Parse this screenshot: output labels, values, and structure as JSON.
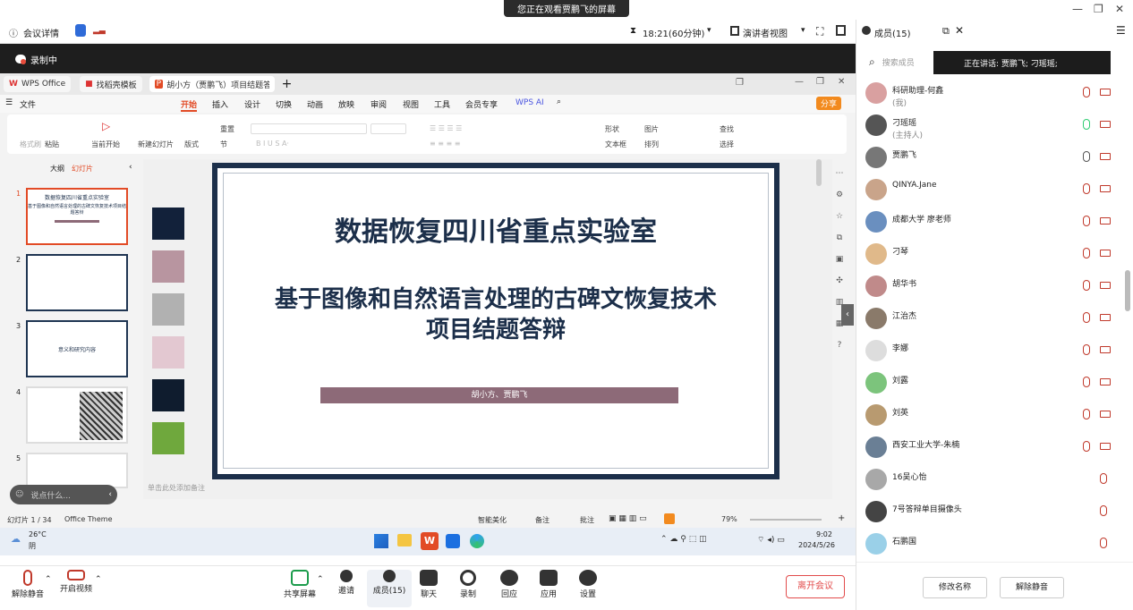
{
  "window": {
    "share_banner": "您正在观看贾鹏飞的屏幕"
  },
  "meeting_bar": {
    "details": "会议详情",
    "time": "18:21(60分钟)",
    "view": "演讲者视图",
    "members_title": "成员(15)"
  },
  "recording": {
    "label": "录制中"
  },
  "wps": {
    "tabs": [
      {
        "label": "WPS Office"
      },
      {
        "label": "找稻壳模板"
      },
      {
        "label": "胡小方（贾鹏飞）项目结题答..."
      }
    ],
    "menus": [
      "文件",
      "开始",
      "插入",
      "设计",
      "切换",
      "动画",
      "放映",
      "审阅",
      "视图",
      "工具",
      "会员专享"
    ],
    "wps_ai": "WPS AI",
    "share": "分享",
    "ribbon": {
      "format_brush": "格式刷",
      "paste": "粘贴",
      "play_from_current": "当前开始",
      "new_slide": "新建幻灯片",
      "layout": "版式",
      "section": "节",
      "reset": "重置",
      "shape": "形状",
      "picture": "图片",
      "textbox": "文本框",
      "arrange": "排列",
      "find": "查找",
      "replace": "替换",
      "select": "选择"
    },
    "panel_tabs": [
      "大纲",
      "幻灯片"
    ],
    "slide_numbers": [
      "1",
      "2",
      "3",
      "4",
      "5"
    ],
    "thumb1": {
      "title": "数据恢复四川省重点实验室",
      "sub": "基于图像和自然语言处理的古碑文恢复技术项目结题答辩"
    },
    "thumb3": {
      "title": "意义和研究内容"
    },
    "comment_placeholder": "说点什么...",
    "notes_hint": "单击此处添加备注",
    "status": {
      "slide_count": "幻灯片 1 / 34",
      "theme": "Office Theme",
      "beautify": "智能美化",
      "notes": "备注",
      "comments": "批注",
      "zoom": "79%"
    }
  },
  "slide": {
    "title": "数据恢复四川省重点实验室",
    "subtitle_line1": "基于图像和自然语言处理的古碑文恢复技术",
    "subtitle_line2": "项目结题答辩",
    "authors": "胡小方、贾鹏飞"
  },
  "swatches": [
    "#12213a",
    "#b895a0",
    "#b1b1b1",
    "#e3c8d1",
    "#0f1c2e",
    "#6fa83d"
  ],
  "taskbar": {
    "temp": "26°C",
    "weather": "阴",
    "time": "9:02",
    "date": "2024/5/26"
  },
  "bottom_bar": {
    "unmute": "解除静音",
    "start_video": "开启视频",
    "share_screen": "共享屏幕",
    "invite": "邀请",
    "members": "成员(15)",
    "chat": "聊天",
    "record": "录制",
    "replay": "回应",
    "apps": "应用",
    "settings": "设置",
    "leave": "离开会议"
  },
  "sidebar": {
    "search_placeholder": "搜索成员",
    "speaking": "正在讲话:  贾鹏飞; 刁瑶瑶;",
    "members": [
      {
        "name": "科研助理-何鑫",
        "sub": "(我)"
      },
      {
        "name": "刁瑶瑶",
        "sub": "(主持人)"
      },
      {
        "name": "贾鹏飞",
        "sub": ""
      },
      {
        "name": "QINYA.Jane",
        "sub": ""
      },
      {
        "name": "成都大学 廖老师",
        "sub": ""
      },
      {
        "name": "刁琴",
        "sub": ""
      },
      {
        "name": "胡华书",
        "sub": ""
      },
      {
        "name": "江治杰",
        "sub": ""
      },
      {
        "name": "李娜",
        "sub": ""
      },
      {
        "name": "刘露",
        "sub": ""
      },
      {
        "name": "刘英",
        "sub": ""
      },
      {
        "name": "西安工业大学-朱楠",
        "sub": ""
      },
      {
        "name": "16吴心怡",
        "sub": ""
      },
      {
        "name": "7号答辩单目摄像头",
        "sub": ""
      },
      {
        "name": "石鹏国",
        "sub": ""
      }
    ],
    "rename": "修改名称",
    "unmute_all": "解除静音"
  }
}
